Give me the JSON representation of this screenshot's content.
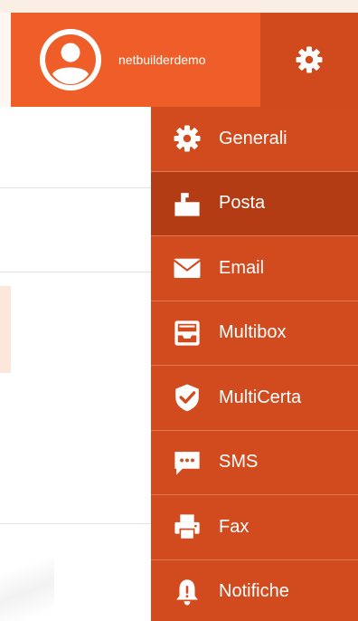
{
  "header": {
    "username": "netbuilderdemo",
    "avatar_icon": "user-circle-icon",
    "settings_icon": "gear-icon"
  },
  "menu": {
    "items": [
      {
        "label": "Generali",
        "icon": "gear-icon",
        "active": false
      },
      {
        "label": "Posta",
        "icon": "mailbox-icon",
        "active": true
      },
      {
        "label": "Email",
        "icon": "envelope-icon",
        "active": false
      },
      {
        "label": "Multibox",
        "icon": "inbox-tray-icon",
        "active": false
      },
      {
        "label": "MultiCerta",
        "icon": "shield-check-icon",
        "active": false
      },
      {
        "label": "SMS",
        "icon": "chat-bubble-icon",
        "active": false
      },
      {
        "label": "Fax",
        "icon": "printer-icon",
        "active": false
      },
      {
        "label": "Notifiche",
        "icon": "bell-icon",
        "active": false
      }
    ]
  },
  "colors": {
    "header_bg": "#ef5e28",
    "settings_bg": "#d04a1e",
    "menu_bg": "#d24b1f",
    "menu_active_bg": "#b33c15"
  }
}
